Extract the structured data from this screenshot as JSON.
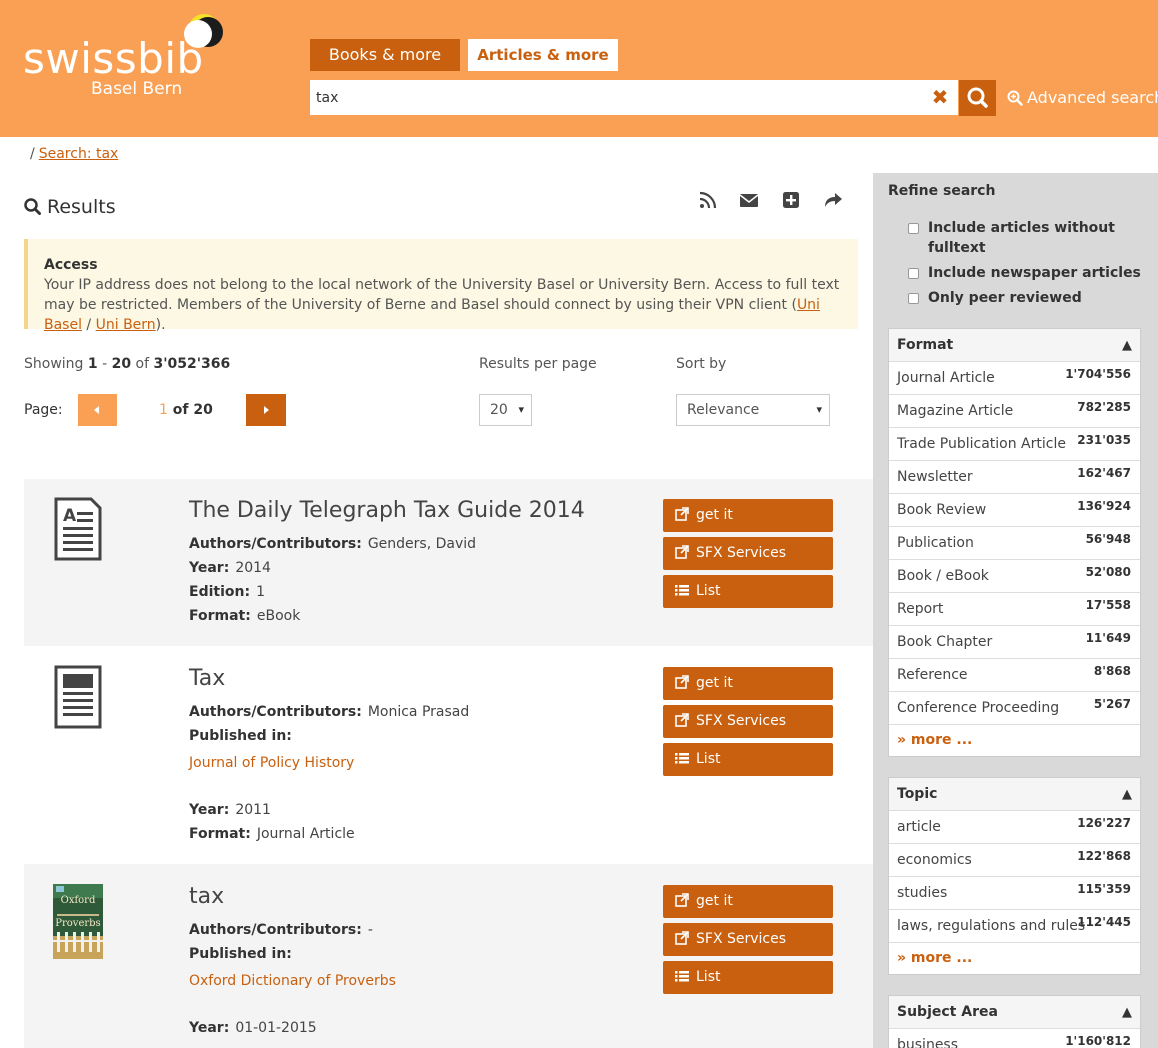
{
  "header": {
    "logo_word": "swissbib",
    "logo_sub": "Basel Bern",
    "tabs": [
      {
        "label": "Books & more"
      },
      {
        "label": "Articles & more"
      }
    ],
    "search_value": "tax",
    "advanced_search": "Advanced search",
    "accent_color": "#c8600f",
    "header_color": "#f9a055"
  },
  "breadcrumb": {
    "sep": "/",
    "link": "Search: tax"
  },
  "results": {
    "title": "Results",
    "toolbar_icons": [
      "rss-icon",
      "envelope-icon",
      "plus-square-icon",
      "share-icon"
    ]
  },
  "alert": {
    "title": "Access",
    "text": "Your IP address does not belong to the local network of the University Basel or University Bern. Access to full text may be restricted. Members of the University of Berne and Basel should connect by using their VPN client (",
    "link1": "Uni Basel",
    "sep": " / ",
    "link2": "Uni Bern",
    "end": ")."
  },
  "paging": {
    "showing_prefix": "Showing ",
    "from": "1",
    "dash": " - ",
    "to": "20",
    "of": " of ",
    "total": "3'052'366",
    "rpp_label": "Results per page",
    "rpp_value": "20",
    "sort_label": "Sort by",
    "sort_value": "Relevance",
    "page_label": "Page:",
    "page_current": "1",
    "page_of": " of 20"
  },
  "records": [
    {
      "title": "The Daily Telegraph Tax Guide 2014",
      "authors_label": "Authors/Contributors:",
      "authors": "Genders, David",
      "year_label": "Year:",
      "year": "2014",
      "edition_label": "Edition:",
      "edition": "1",
      "format_label": "Format:",
      "format": "eBook",
      "icon": "ebook-icon"
    },
    {
      "title": "Tax",
      "authors_label": "Authors/Contributors:",
      "authors": "Monica Prasad",
      "published_label": "Published in:",
      "published_in": "Journal of Policy History",
      "year_label": "Year:",
      "year": "2011",
      "format_label": "Format:",
      "format": "Journal Article",
      "icon": "article-icon"
    },
    {
      "title": "tax",
      "authors_label": "Authors/Contributors:",
      "authors": "-",
      "published_label": "Published in:",
      "published_in": "Oxford Dictionary of Proverbs",
      "year_label": "Year:",
      "year": "01-01-2015",
      "cover_text_1": "Oxford",
      "cover_text_2": "Proverbs",
      "icon": "book-cover-image"
    }
  ],
  "record_buttons": {
    "get_it": "get it",
    "sfx": "SFX Services",
    "list": "List"
  },
  "sidebar": {
    "refine_title": "Refine search",
    "checkboxes": [
      {
        "label": "Include articles without fulltext",
        "checked": false
      },
      {
        "label": "Include newspaper articles",
        "checked": false
      },
      {
        "label": "Only peer reviewed",
        "checked": false
      }
    ],
    "format": {
      "title": "Format",
      "arrow": "▲",
      "items": [
        {
          "label": "Journal Article",
          "count": "1'704'556"
        },
        {
          "label": "Magazine Article",
          "count": "782'285"
        },
        {
          "label": "Trade Publication Article",
          "count": "231'035"
        },
        {
          "label": "Newsletter",
          "count": "162'467"
        },
        {
          "label": "Book Review",
          "count": "136'924"
        },
        {
          "label": "Publication",
          "count": "56'948"
        },
        {
          "label": "Book / eBook",
          "count": "52'080"
        },
        {
          "label": "Report",
          "count": "17'558"
        },
        {
          "label": "Book Chapter",
          "count": "11'649"
        },
        {
          "label": "Reference",
          "count": "8'868"
        },
        {
          "label": "Conference Proceeding",
          "count": "5'267"
        }
      ],
      "more": "» more ..."
    },
    "topic": {
      "title": "Topic",
      "arrow": "▲",
      "items": [
        {
          "label": "article",
          "count": "126'227"
        },
        {
          "label": "economics",
          "count": "122'868"
        },
        {
          "label": "studies",
          "count": "115'359"
        },
        {
          "label": "laws, regulations and rules",
          "count": "112'445"
        }
      ],
      "more": "» more ..."
    },
    "subject_area": {
      "title": "Subject Area",
      "arrow": "▲",
      "items": [
        {
          "label": "business",
          "count": "1'160'812"
        }
      ]
    }
  }
}
